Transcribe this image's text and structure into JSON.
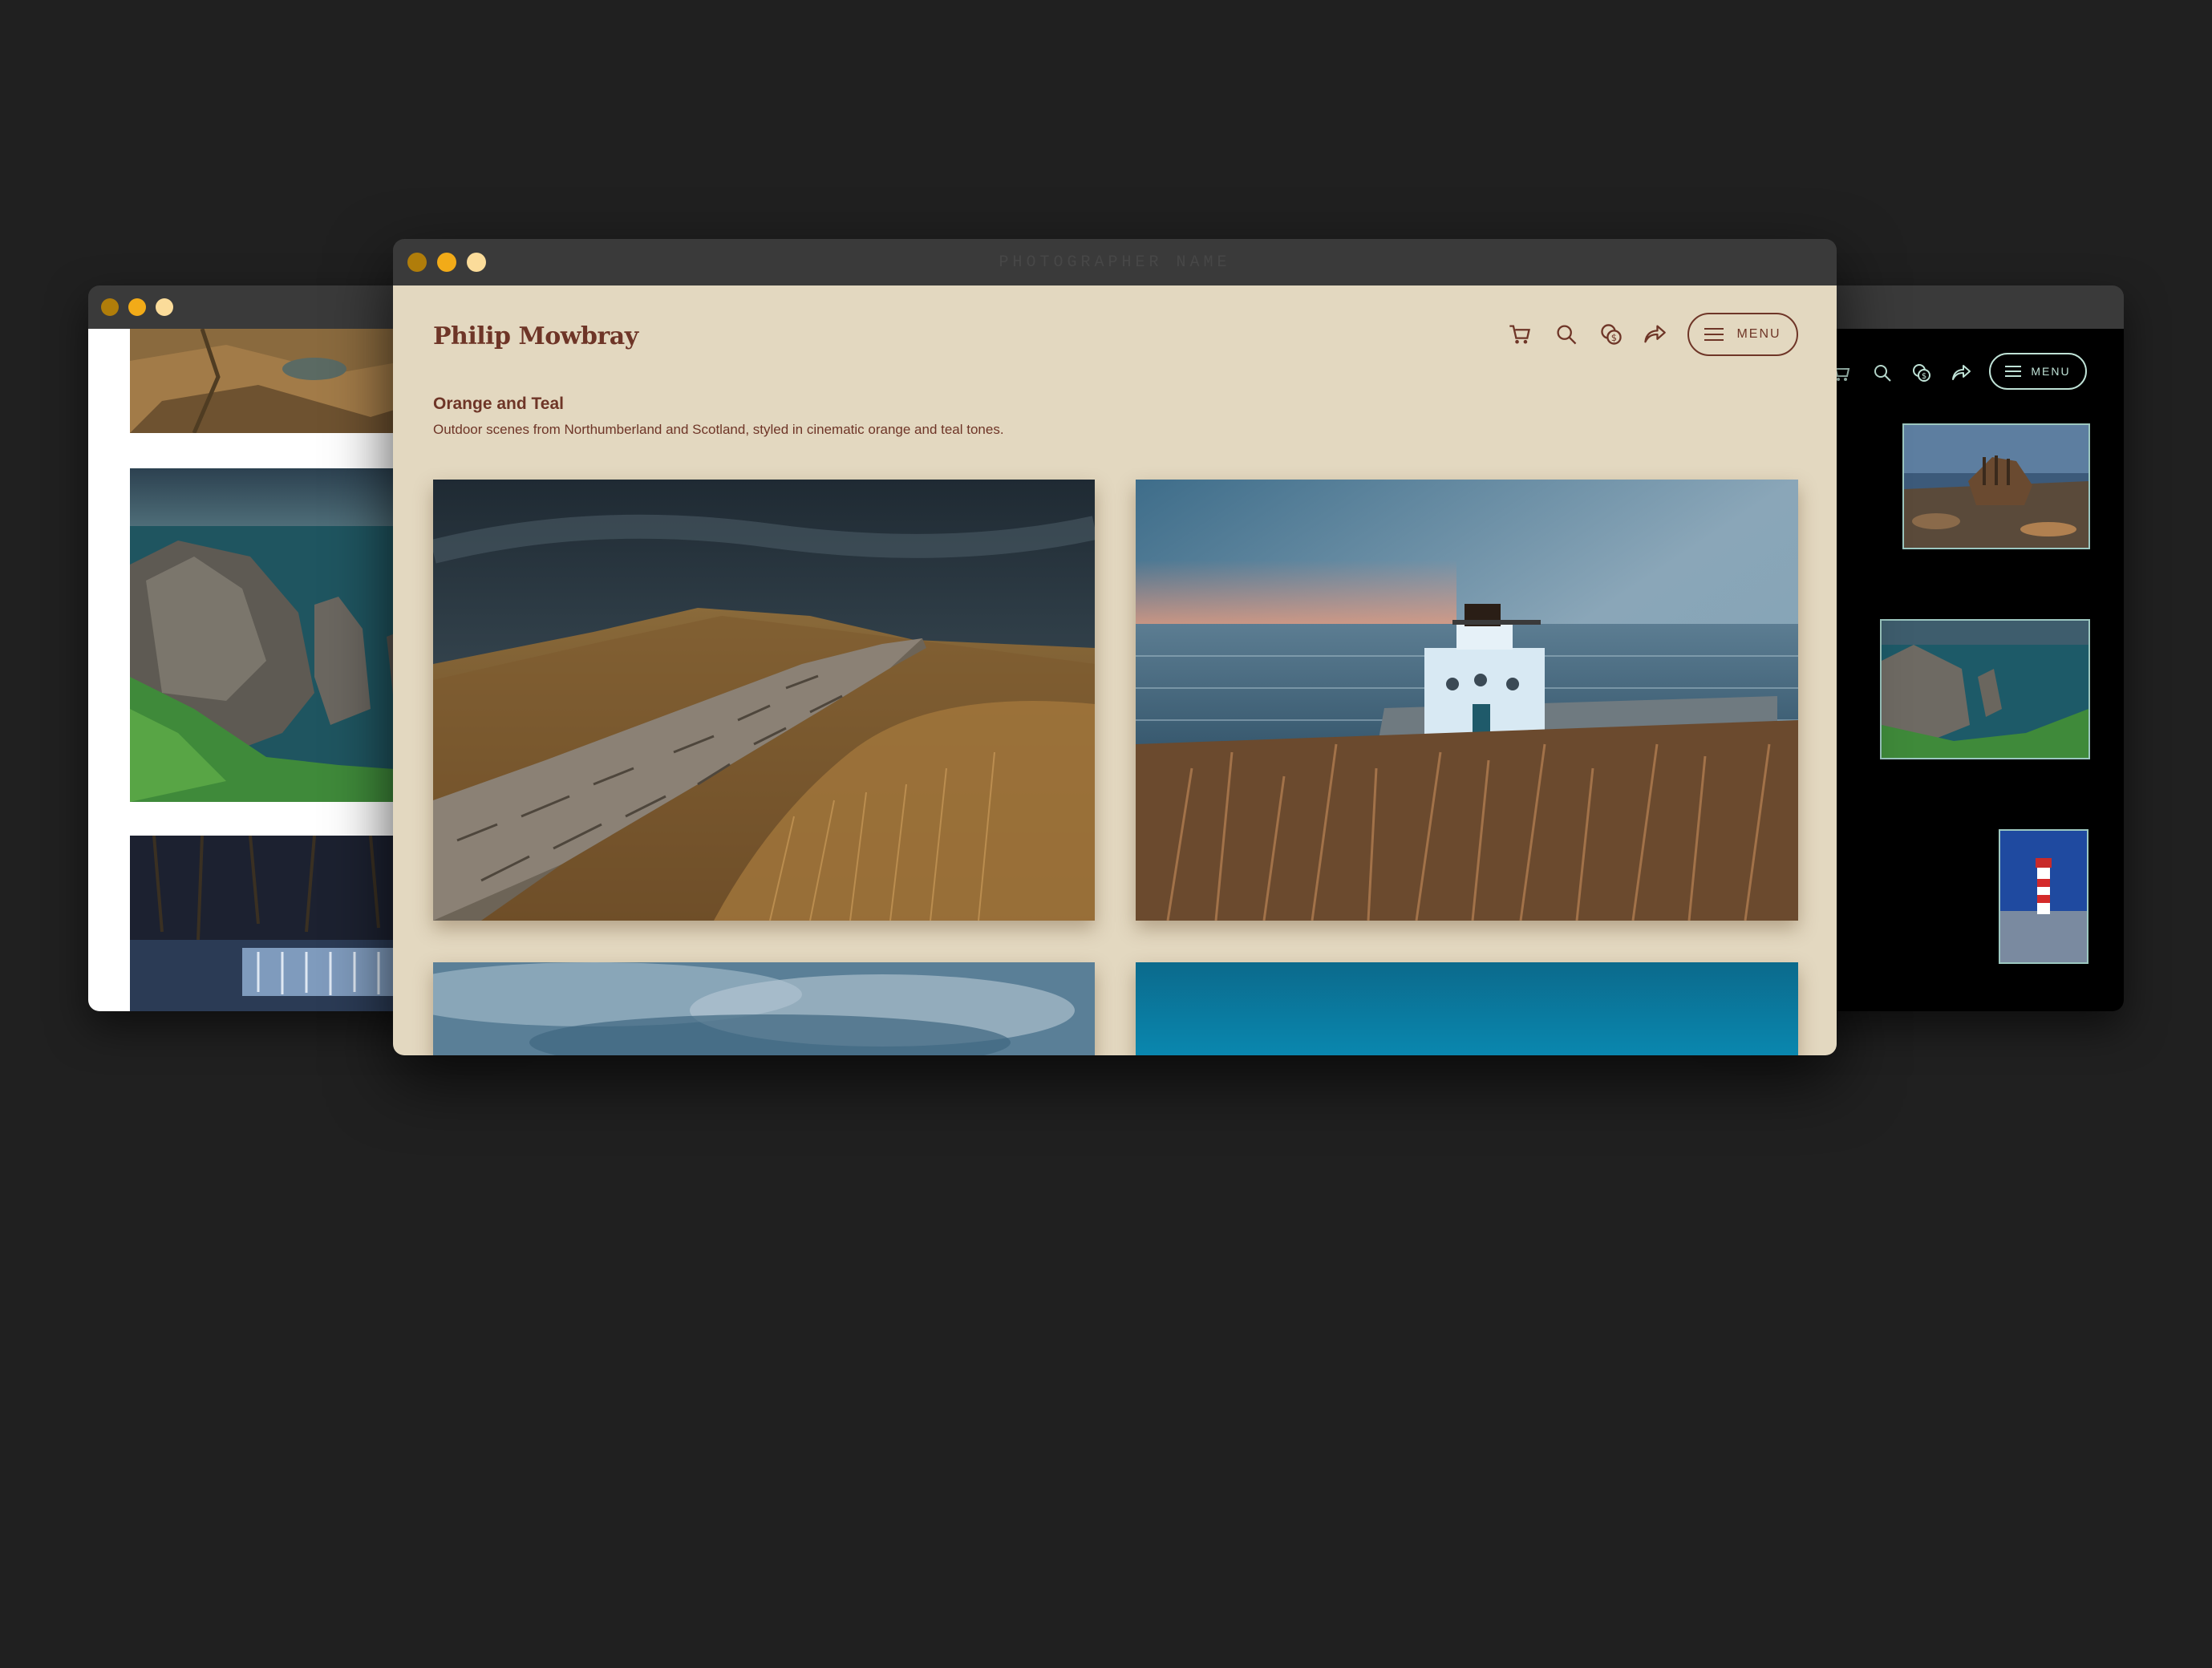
{
  "windows": {
    "left": {
      "traffic_lights": [
        "#b07d0a",
        "#f2ab18",
        "#fbdc9a"
      ]
    },
    "main": {
      "title": "PHOTOGRAPHER NAME",
      "traffic_lights": [
        "#b07d0a",
        "#f2ab18",
        "#fbdc9a"
      ],
      "theme": {
        "background": "#e3d8c0",
        "accent": "#6e3527"
      }
    },
    "right": {
      "theme": {
        "background": "#000000",
        "accent": "#bfe2d6"
      }
    }
  },
  "site": {
    "brand": "Philip Mowbray",
    "nav": {
      "icons": [
        "cart-icon",
        "search-icon",
        "currency-icon",
        "share-icon"
      ],
      "menu_label": "MENU"
    }
  },
  "gallery": {
    "title": "Orange and Teal",
    "description": "Outdoor scenes from Northumberland and Scotland, styled in cinematic orange and teal tones."
  },
  "right_nav": {
    "menu_label": "MENU"
  }
}
